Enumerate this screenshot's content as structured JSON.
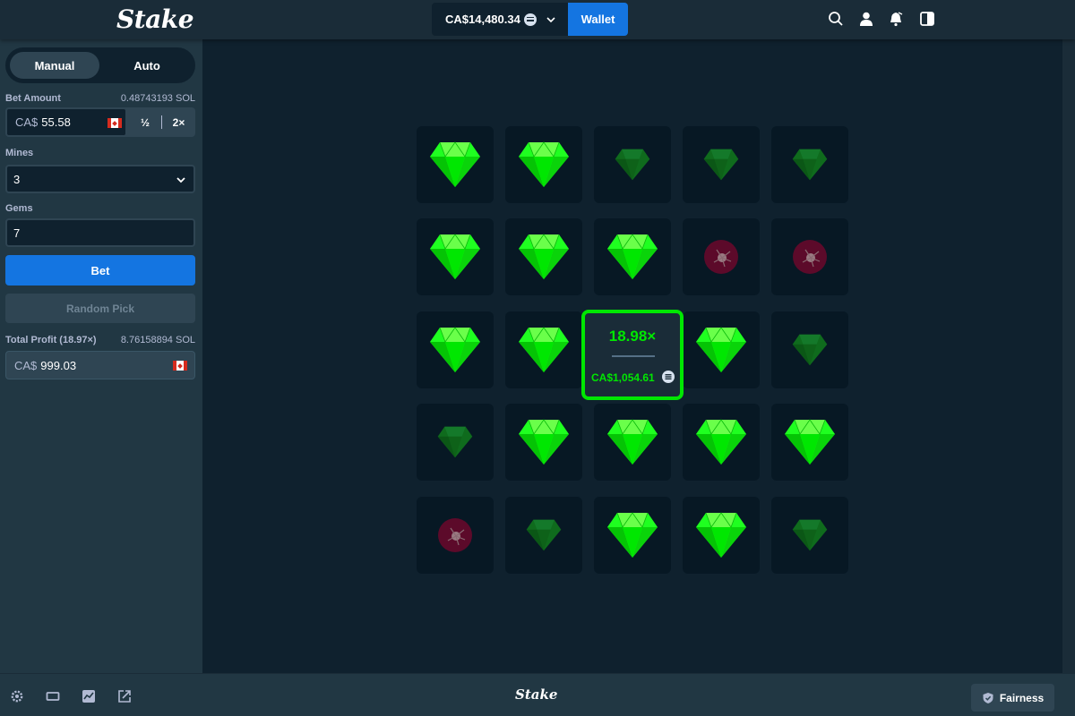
{
  "header": {
    "logo": "Stake",
    "balance": "CA$14,480.34",
    "wallet_label": "Wallet"
  },
  "sidebar": {
    "tabs": [
      {
        "label": "Manual",
        "active": true
      },
      {
        "label": "Auto",
        "active": false
      }
    ],
    "bet_amount_label": "Bet Amount",
    "bet_amount_crypto": "0.48743193 SOL",
    "bet_currency": "CA$",
    "bet_amount": "55.58",
    "half_label": "½",
    "double_label": "2×",
    "mines_label": "Mines",
    "mines_value": "3",
    "gems_label": "Gems",
    "gems_value": "7",
    "bet_button": "Bet",
    "random_pick_button": "Random Pick",
    "profit_label": "Total Profit (18.97×)",
    "profit_crypto": "8.76158894 SOL",
    "profit_currency": "CA$",
    "profit_value": "999.03"
  },
  "game": {
    "grid": [
      [
        "gem",
        "gem",
        "gem-dim",
        "gem-dim",
        "gem-dim"
      ],
      [
        "gem",
        "gem",
        "gem",
        "mine",
        "mine"
      ],
      [
        "gem",
        "gem",
        "result",
        "gem",
        "gem-dim"
      ],
      [
        "gem-dim",
        "gem",
        "gem",
        "gem",
        "gem"
      ],
      [
        "mine",
        "gem-dim",
        "gem",
        "gem",
        "gem-dim"
      ]
    ],
    "result_multiplier": "18.98×",
    "result_amount": "CA$1,054.61"
  },
  "footer": {
    "logo": "Stake",
    "fairness_label": "Fairness"
  },
  "colors": {
    "accent_blue": "#1475e1",
    "gem_green": "#00e701",
    "mine_red": "#5c0a2a"
  }
}
